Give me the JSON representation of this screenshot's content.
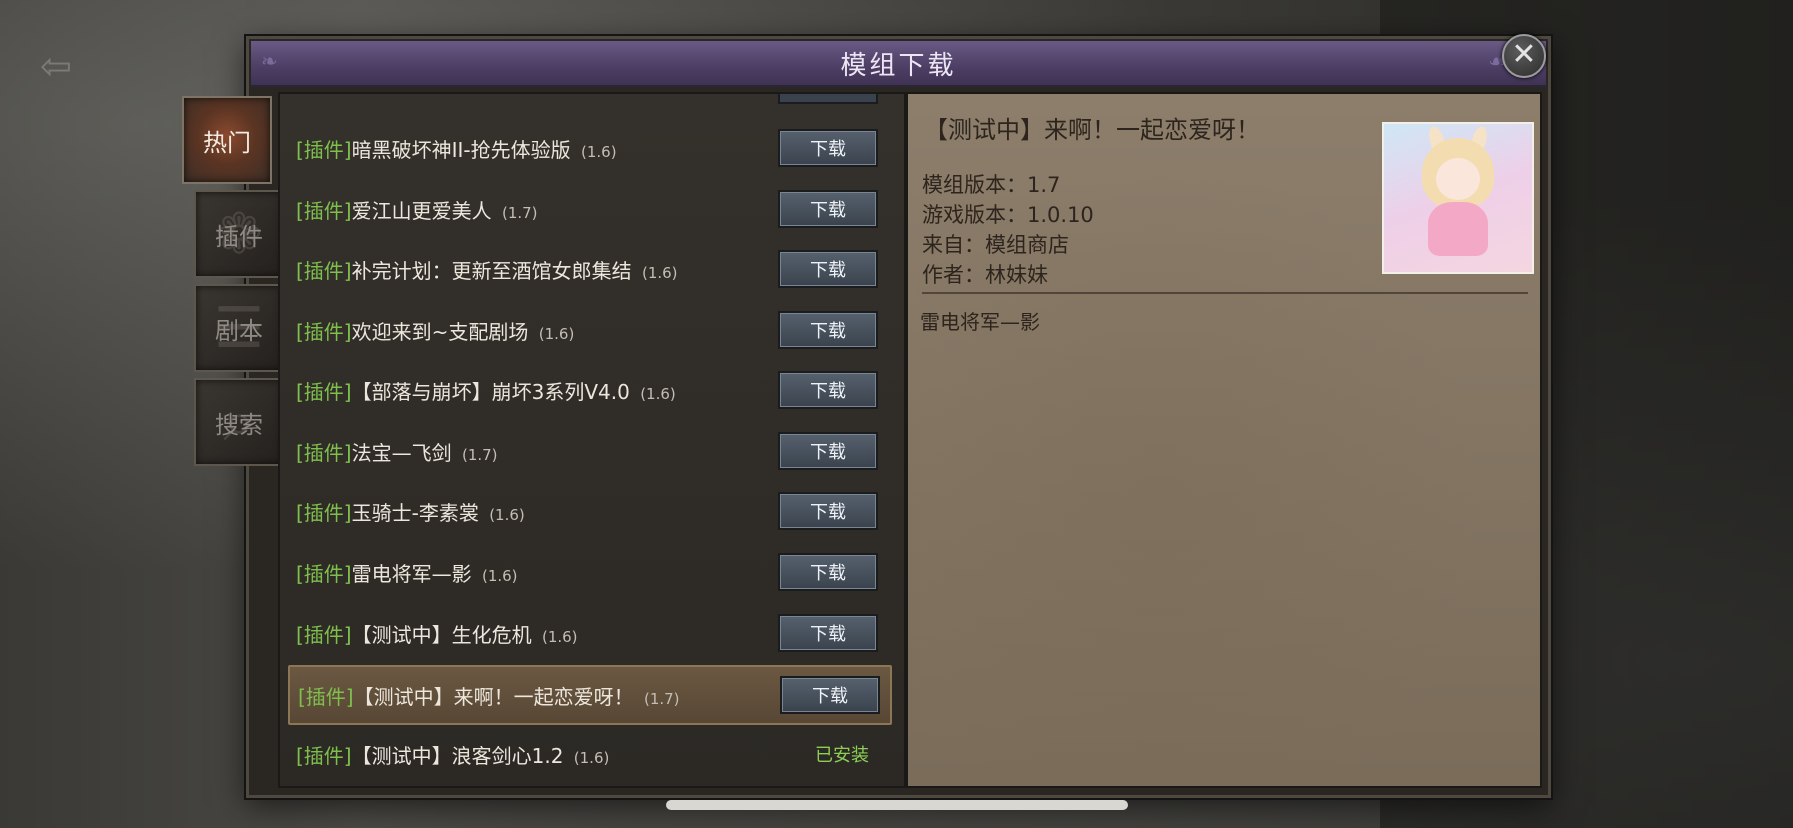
{
  "window": {
    "title": "模组下载"
  },
  "tabs": [
    {
      "label": "热门",
      "active": true
    },
    {
      "label": "插件",
      "active": false
    },
    {
      "label": "剧本",
      "active": false
    },
    {
      "label": "搜索",
      "active": false
    }
  ],
  "list": {
    "download_label": "下载",
    "installed_label": "已安装",
    "items": [
      {
        "tag": "[插件]",
        "name": "暗黑破坏神II-抢先体验版",
        "version": "(1.6)",
        "status": "download"
      },
      {
        "tag": "[插件]",
        "name": "爱江山更爱美人",
        "version": "(1.7)",
        "status": "download"
      },
      {
        "tag": "[插件]",
        "name": "补完计划：更新至酒馆女郎集结",
        "version": "(1.6)",
        "status": "download"
      },
      {
        "tag": "[插件]",
        "name": "欢迎来到~支配剧场",
        "version": "(1.6)",
        "status": "download"
      },
      {
        "tag": "[插件]",
        "name": "【部落与崩坏】崩坏3系列V4.0",
        "version": "(1.6)",
        "status": "download"
      },
      {
        "tag": "[插件]",
        "name": "法宝—飞剑",
        "version": "(1.7)",
        "status": "download"
      },
      {
        "tag": "[插件]",
        "name": "玉骑士-李素裳",
        "version": "(1.6)",
        "status": "download"
      },
      {
        "tag": "[插件]",
        "name": "雷电将军—影",
        "version": "(1.6)",
        "status": "download"
      },
      {
        "tag": "[插件]",
        "name": "【测试中】生化危机",
        "version": "(1.6)",
        "status": "download"
      },
      {
        "tag": "[插件]",
        "name": "【测试中】来啊！一起恋爱呀！",
        "version": "(1.7)",
        "status": "download",
        "selected": true
      },
      {
        "tag": "[插件]",
        "name": "【测试中】浪客剑心1.2",
        "version": "(1.6)",
        "status": "installed"
      }
    ]
  },
  "detail": {
    "title": "【测试中】来啊！一起恋爱呀！",
    "mod_version": "模组版本：1.7",
    "game_version": "游戏版本：1.0.10",
    "source": "来自：模组商店",
    "author": "作者：林妹妹",
    "description": "雷电将军—影"
  },
  "icons": {
    "close": "close-icon",
    "back": "back-arrow-icon"
  },
  "colors": {
    "tag_green": "#7fc04d",
    "installed_green": "#8ccf55",
    "title_purple": "#5a4a76",
    "parchment": "#8c7e6b"
  }
}
